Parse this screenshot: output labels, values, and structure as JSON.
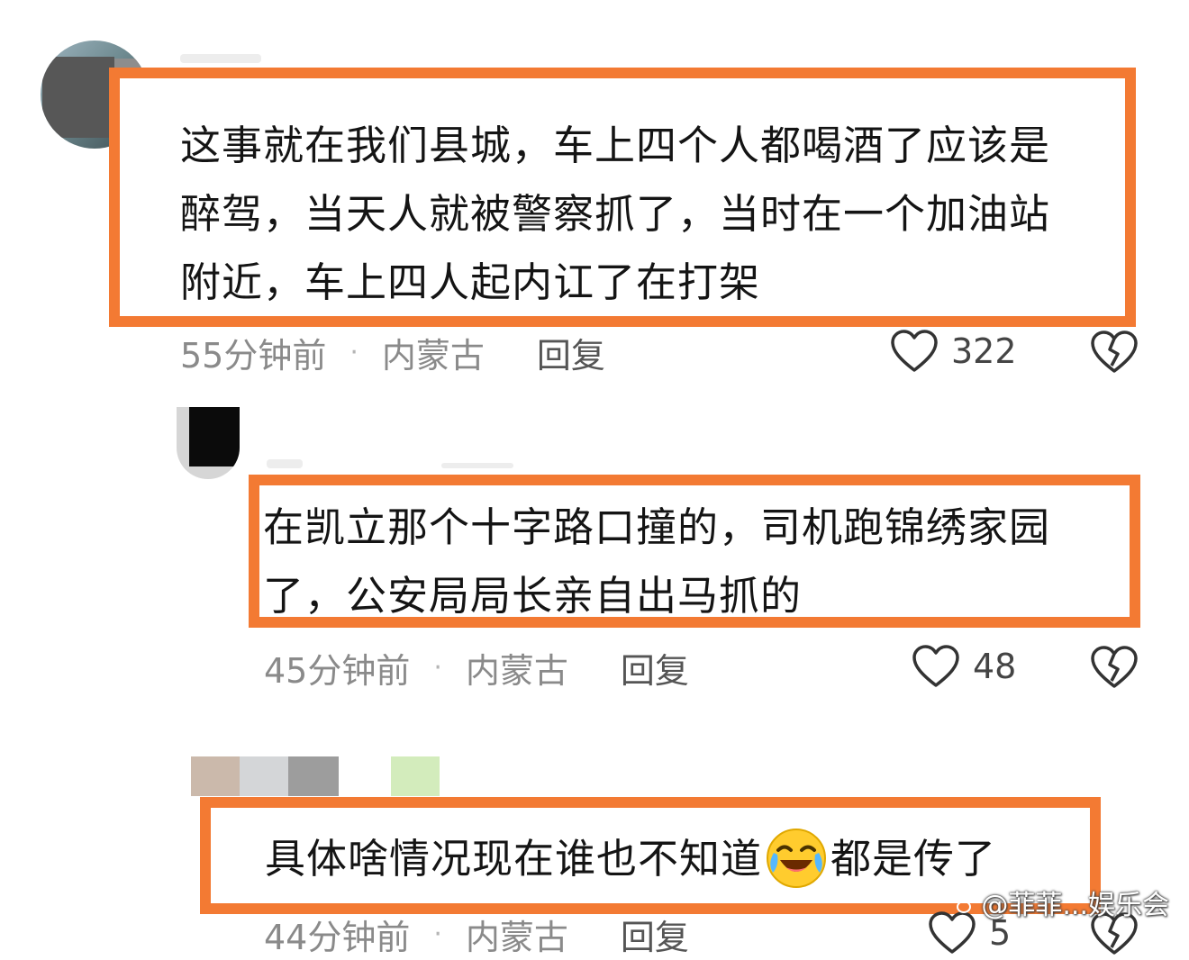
{
  "comments": [
    {
      "lines": [
        "这事就在我们县城，车上四个人都喝酒了应该是",
        "醉驾，当天人就被警察抓了，当时在一个加油站",
        "附近，车上四人起内讧了在打架"
      ],
      "time": "55分钟前",
      "location": "内蒙古",
      "reply_label": "回复",
      "likes": "322"
    },
    {
      "lines": [
        "在凯立那个十字路口撞的，司机跑锦绣家园",
        "了，公安局局长亲自出马抓的"
      ],
      "time": "45分钟前",
      "location": "内蒙古",
      "reply_label": "回复",
      "likes": "48"
    },
    {
      "text_before_emoji": "具体啥情况现在谁也不知道",
      "emoji": "laughing-crying-emoji",
      "text_after_emoji": "都是传了",
      "time": "44分钟前",
      "location": "内蒙古",
      "reply_label": "回复",
      "likes": "5"
    }
  ],
  "separator": "·",
  "watermark": "@菲菲...娱乐会",
  "colors": {
    "highlight_border": "#f37a33",
    "meta_text": "#8a8a8a"
  },
  "icons": {
    "like": "heart-outline-icon",
    "dislike": "broken-heart-icon",
    "watermark": "paw-icon"
  }
}
